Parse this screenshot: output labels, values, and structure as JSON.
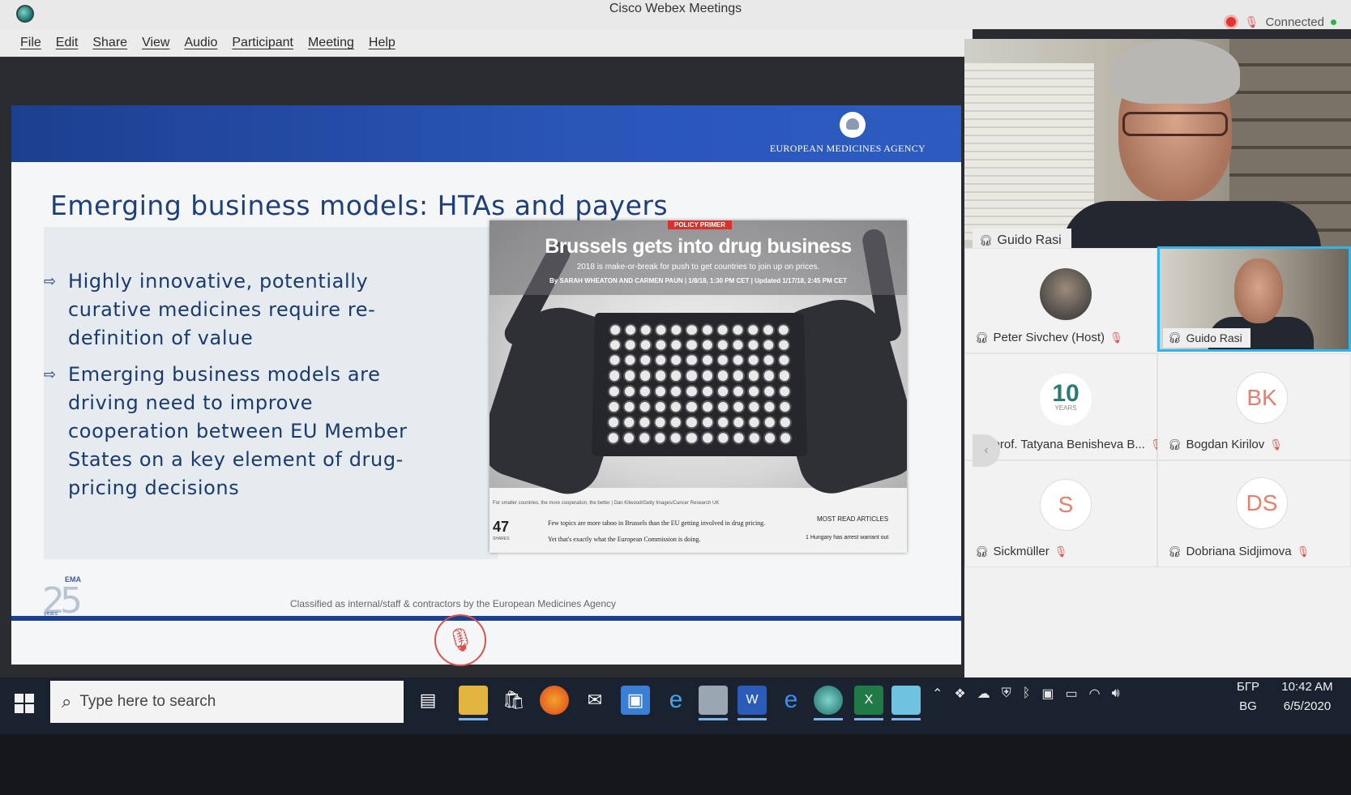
{
  "window": {
    "title": "Cisco Webex Meetings",
    "status": "Connected"
  },
  "menu": [
    "File",
    "Edit",
    "Share",
    "View",
    "Audio",
    "Participant",
    "Meeting",
    "Help"
  ],
  "slide": {
    "org": "EUROPEAN MEDICINES AGENCY",
    "title": "Emerging business models: HTAs and payers",
    "bullets": [
      "Highly innovative, potentially curative medicines require re-definition of value",
      "Emerging business models are driving need to improve cooperation between EU Member States on a key element of drug-pricing decisions"
    ],
    "article": {
      "tag": "POLICY PRIMER",
      "headline": "Brussels gets into drug business",
      "subhead": "2018 is make-or-break for push to get countries to join up on prices.",
      "byline": "By SARAH WHEATON AND CARMEN PAUN | 1/8/18, 1:30 PM CET | Updated 1/17/18, 2:45 PM CET",
      "caption": "For smaller countries, the more cooperation, the better | Dan Kitwood/Getty Images/Cancer Research UK",
      "views": "47",
      "views_label": "SHARES",
      "text_1": "Few topics are more taboo in Brussels than the EU getting involved in drug pricing.",
      "text_2": "Yet that's exactly what the European Commission is doing.",
      "most_read": "MOST READ ARTICLES",
      "most_read_item": "1   Hungary has arrest warrant out"
    },
    "anniversary": {
      "small": "EMA",
      "number": "25",
      "label": "years"
    },
    "classification": "Classified as internal/staff & contractors by the European Medicines Agency"
  },
  "participants": {
    "active_speaker": "Guido Rasi",
    "tiles": [
      {
        "name": "Peter Sivchev (Host)",
        "avatar": "",
        "muted": true
      },
      {
        "name": "Guido Rasi",
        "avatar": "",
        "muted": false
      },
      {
        "name": "prof. Tatyana Benisheva B...",
        "avatar": "10",
        "avatar_sub": "YEARS",
        "muted": true
      },
      {
        "name": "Bogdan Kirilov",
        "avatar": "BK",
        "muted": true
      },
      {
        "name": "Sickmüller",
        "avatar": "S",
        "muted": true
      },
      {
        "name": "Dobriana Sidjimova",
        "avatar": "DS",
        "muted": true
      }
    ]
  },
  "taskbar": {
    "search_placeholder": "Type here to search",
    "language_top": "БГР",
    "language_bottom": "BG",
    "time": "10:42 AM",
    "date": "6/5/2020"
  },
  "colors": {
    "brand_blue": "#1d3f8f",
    "active_border": "#35b3e8",
    "mute_red": "#d9534f"
  }
}
